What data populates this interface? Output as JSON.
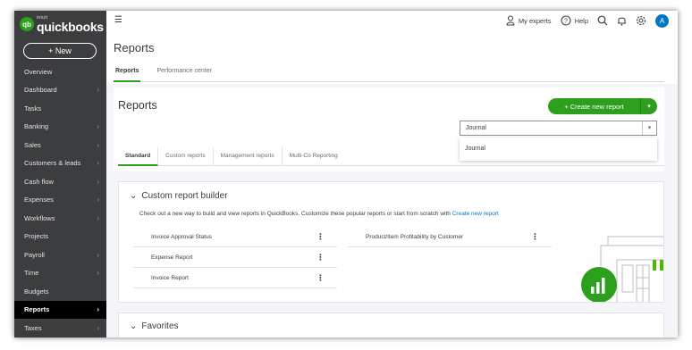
{
  "app": {
    "brand_small": "intuit",
    "brand_name": "quickbooks",
    "brand_badge": "qb"
  },
  "sidebar": {
    "new_label": "+ New",
    "items": [
      {
        "label": "Overview",
        "chevron": false
      },
      {
        "label": "Dashboard",
        "chevron": true
      },
      {
        "label": "Tasks",
        "chevron": false
      },
      {
        "label": "Banking",
        "chevron": true
      },
      {
        "label": "Sales",
        "chevron": true
      },
      {
        "label": "Customers & leads",
        "chevron": true
      },
      {
        "label": "Cash flow",
        "chevron": true
      },
      {
        "label": "Expenses",
        "chevron": true
      },
      {
        "label": "Workflows",
        "chevron": true
      },
      {
        "label": "Projects",
        "chevron": false
      },
      {
        "label": "Payroll",
        "chevron": true
      },
      {
        "label": "Time",
        "chevron": true
      },
      {
        "label": "Budgets",
        "chevron": false
      },
      {
        "label": "Reports",
        "chevron": true
      },
      {
        "label": "Taxes",
        "chevron": true
      }
    ]
  },
  "topbar": {
    "my_experts": "My experts",
    "help": "Help",
    "avatar_initial": "A"
  },
  "page": {
    "title": "Reports",
    "tabs": [
      "Reports",
      "Performance center"
    ],
    "section_title": "Reports",
    "create_button": "+ Create new report",
    "search_value": "Journal",
    "dropdown_option": "Journal",
    "sub_tabs": [
      "Standard",
      "Custom reports",
      "Management reports",
      "Multi-Co Reporting"
    ]
  },
  "custom_builder": {
    "title": "Custom report builder",
    "description": "Check out a new way to build and view reports in QuickBooks. Customize these popular reports or start from scratch with",
    "link": "Create new report",
    "left_reports": [
      "Invoice Approval Status",
      "Expense Report",
      "Invoice Report"
    ],
    "right_reports": [
      "Product/Item Profitability by Customer"
    ]
  },
  "favorites": {
    "title": "Favorites"
  },
  "colors": {
    "accent": "#2ca01c",
    "sidebar": "#3c3d3f",
    "link": "#0077c5"
  }
}
